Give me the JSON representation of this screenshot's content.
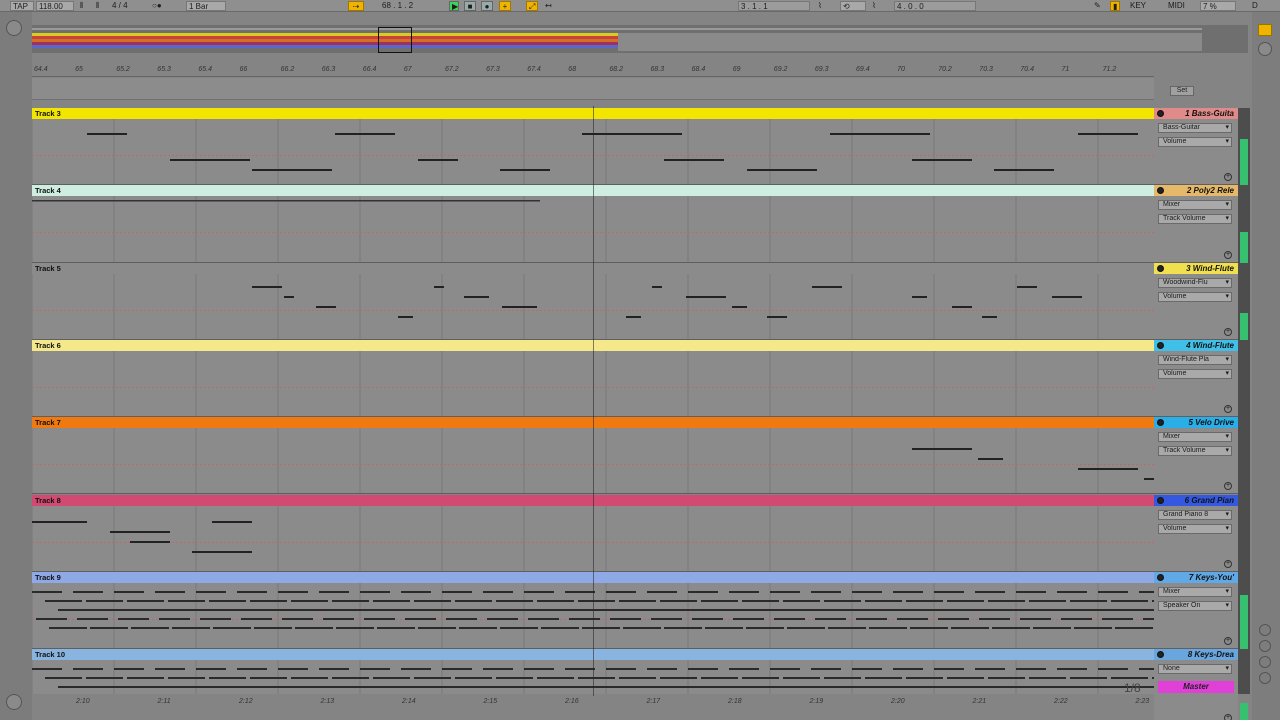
{
  "control_bar": {
    "tap": "TAP",
    "tempo": "118.00",
    "signature": "4 / 4",
    "quantize": "1 Bar",
    "position": "68 .  1 .  2",
    "loop_start": "3 .  1 .  1",
    "loop_length": "4 .  0 .  0",
    "key": "KEY",
    "midi": "MIDI",
    "cpu": "7 %",
    "d": "D"
  },
  "ruler_top": [
    "64.4",
    "65",
    "65.2",
    "65.3",
    "65.4",
    "66",
    "66.2",
    "66.3",
    "66.4",
    "67",
    "67.2",
    "67.3",
    "67.4",
    "68",
    "68.2",
    "68.3",
    "68.4",
    "69",
    "69.2",
    "69.3",
    "69.4",
    "70",
    "70.2",
    "70.3",
    "70.4",
    "71",
    "71.2"
  ],
  "ruler_bottom": [
    "2:10",
    "2:11",
    "2:12",
    "2:13",
    "2:14",
    "2:15",
    "2:16",
    "2:17",
    "2:18",
    "2:19",
    "2:20",
    "2:21",
    "2:22",
    "2:23"
  ],
  "set_label": "Set",
  "lanes": [
    {
      "clip": "Track 3",
      "color": "#f2e600",
      "head": "1 Bass-Guita",
      "head_color": "#e08a8a",
      "sel1": "Bass-Guitar",
      "sel2": "Volume"
    },
    {
      "clip": "Track 4",
      "color": "#cdeee0",
      "head": "2 Poly2 Rele",
      "head_color": "#e6b86a",
      "sel1": "Mixer",
      "sel2": "Track Volume"
    },
    {
      "clip": "Track 5",
      "color": "#8b8b8b",
      "head": "3 Wind-Flute",
      "head_color": "#f0e050",
      "sel1": "Woodwind-Flu",
      "sel2": "Volume"
    },
    {
      "clip": "Track 6",
      "color": "#f4e88a",
      "head": "4 Wind-Flute",
      "head_color": "#40c0e8",
      "sel1": "Wind-Flute Pla",
      "sel2": "Volume"
    },
    {
      "clip": "Track 7",
      "color": "#f07a10",
      "head": "5 Velo Drive",
      "head_color": "#2aaee8",
      "sel1": "Mixer",
      "sel2": "Track Volume"
    },
    {
      "clip": "Track 8",
      "color": "#d04a72",
      "head": "6 Grand Pian",
      "head_color": "#3458e0",
      "sel1": "Grand Piano 8",
      "sel2": "Volume"
    },
    {
      "clip": "Track 9",
      "color": "#8fa8e6",
      "head": "7 Keys-You'",
      "head_color": "#60a8e6",
      "sel1": "Mixer",
      "sel2": "Speaker On"
    },
    {
      "clip": "Track 10",
      "color": "#8ab4e0",
      "head": "8 Keys-Drea",
      "head_color": "#6aa6de",
      "sel1": "None",
      "sel2": ""
    }
  ],
  "master": "Master",
  "master_color": "#e040d8",
  "ratio": "1/8"
}
